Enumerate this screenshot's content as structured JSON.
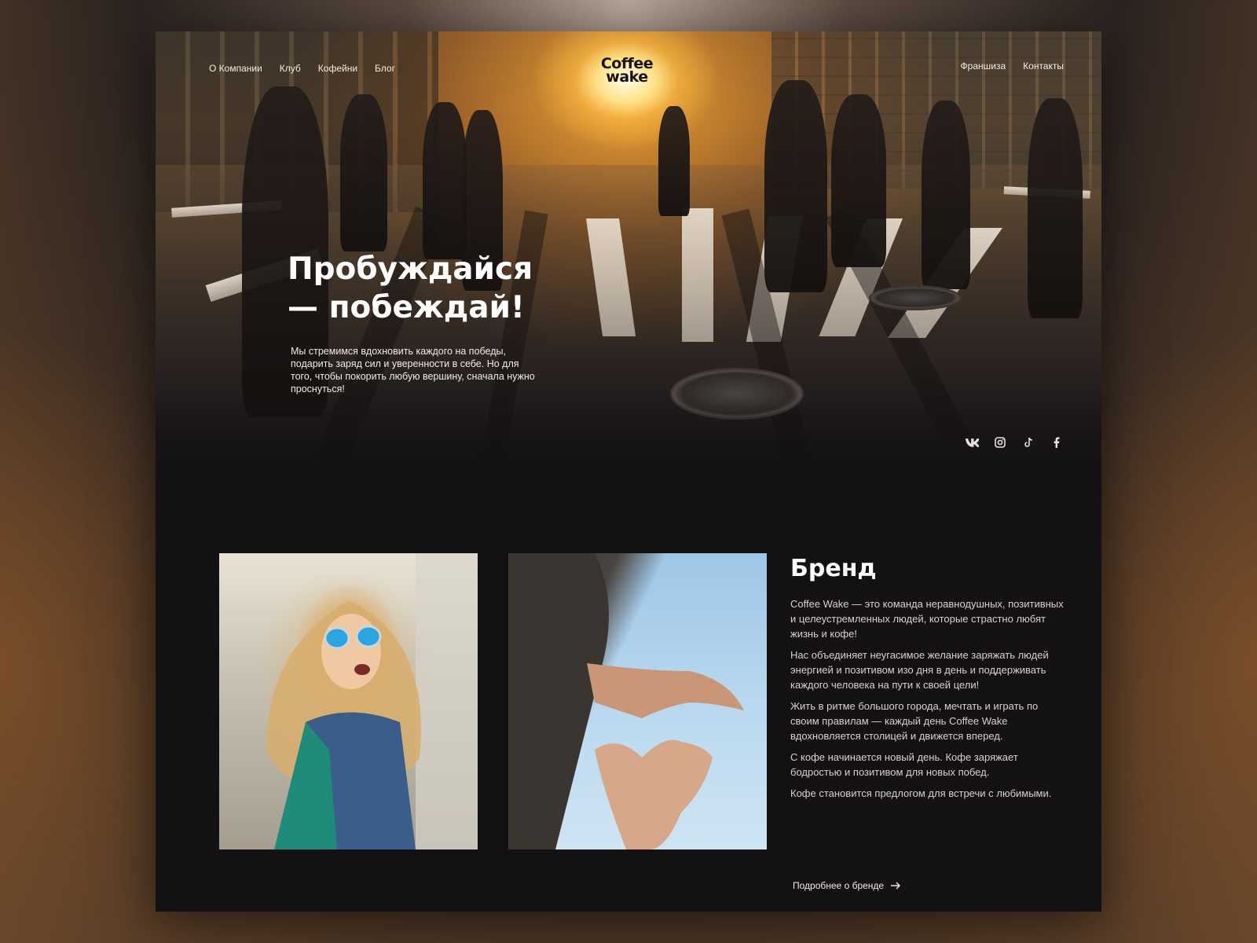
{
  "nav": {
    "left": [
      "О Компании",
      "Клуб",
      "Кофейни",
      "Блог"
    ],
    "right": [
      "Франшиза",
      "Контакты"
    ]
  },
  "logo": {
    "line1": "Coffee",
    "line2": "wake"
  },
  "hero": {
    "title": "Пробуждайся — побеждай!",
    "text": "Мы стремимся вдохновить каждого на победы, подарить заряд сил и уверенности в себе. Но для того, чтобы покорить любую вершину, сначала нужно проснуться!"
  },
  "social": [
    "vk-icon",
    "instagram-icon",
    "tiktok-icon",
    "facebook-icon"
  ],
  "brand": {
    "title": "Бренд",
    "paragraphs": [
      "Coffee Wake — это команда неравнодушных, позитивных и целеустремленных людей, которые страстно любят жизнь и кофе!",
      "Нас объединяет неугасимое желание заряжать людей энергией и позитивом изо дня в день и поддерживать каждого человека на пути к своей цели!",
      "Жить в ритме большого города, мечтать и играть по своим правилам — каждый день Coffee Wake вдохновляется столицей и движется вперед.",
      "С кофе начинается новый день. Кофе заряжает бодростью и позитивом для новых побед.",
      "Кофе становится предлогом для встречи с любимыми."
    ],
    "more_label": "Подробнее о бренде"
  },
  "colors": {
    "page_bg": "#131114",
    "accent_sun": "#ffb84a",
    "text_light": "#f4ede4"
  }
}
